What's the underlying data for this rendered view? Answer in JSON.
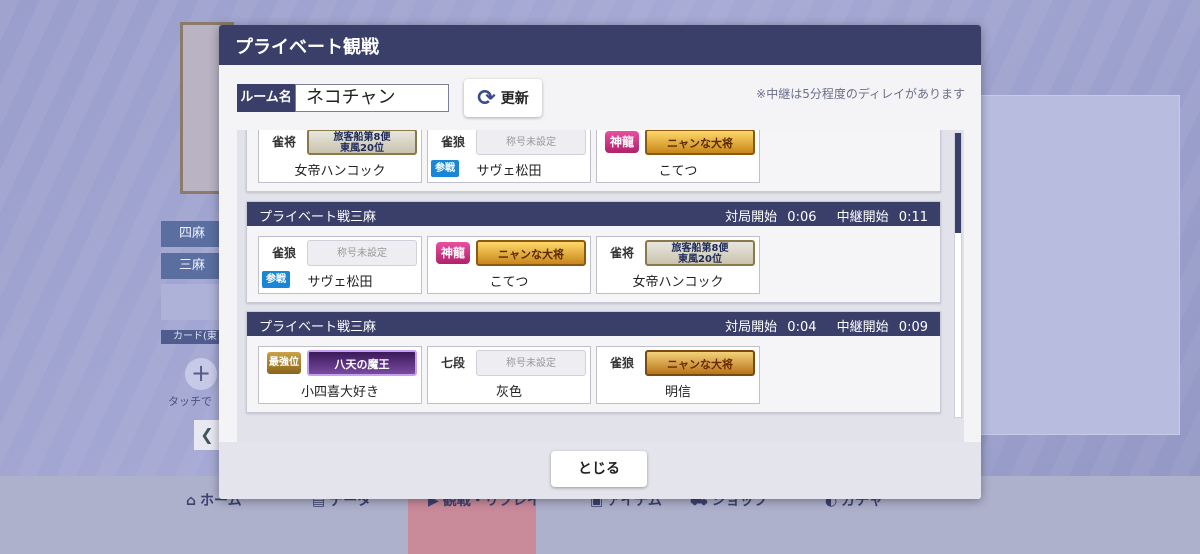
{
  "background": {
    "modes": [
      "四麻",
      "三麻"
    ],
    "card_label": "カード(東",
    "touch_text": "タッチで",
    "nav": [
      {
        "label": "ホーム",
        "icon": "home-icon",
        "glyph": "⌂"
      },
      {
        "label": "データ",
        "icon": "data-icon",
        "glyph": "▤"
      },
      {
        "label": "観戦・リプレイ",
        "icon": "replay-icon",
        "glyph": "▶"
      },
      {
        "label": "アイテム",
        "icon": "item-icon",
        "glyph": "▣"
      },
      {
        "label": "ショップ",
        "icon": "shop-icon",
        "glyph": "⛟"
      },
      {
        "label": "ガチャ",
        "icon": "gacha-icon",
        "glyph": "◐"
      }
    ]
  },
  "modal": {
    "title": "プライベート観戦",
    "delay_note": "※中継は5分程度のディレイがあります",
    "room_label": "ルーム名",
    "room_value": "ネコチャン",
    "refresh_label": "更新",
    "close_label": "とじる",
    "matches": [
      {
        "name": "",
        "start_label": "",
        "start": "",
        "relay_label": "",
        "relay": "",
        "players": [
          {
            "rank": "雀将",
            "rank_style": "plain",
            "title": "旅客船第8便\n東風20位",
            "title_style": "ship",
            "name": "女帝ハンコック",
            "join": ""
          },
          {
            "rank": "雀狼",
            "rank_style": "plain",
            "title": "称号未設定",
            "title_style": "unset",
            "name": "サヴェ松田",
            "join": "参戦"
          },
          {
            "rank": "神龍",
            "rank_style": "hot",
            "title": "ニャンな大将",
            "title_style": "gold",
            "name": "こてつ",
            "join": ""
          }
        ]
      },
      {
        "name": "プライベート戦三麻",
        "start_label": "対局開始",
        "start": "0:06",
        "relay_label": "中継開始",
        "relay": "0:11",
        "players": [
          {
            "rank": "雀狼",
            "rank_style": "plain",
            "title": "称号未設定",
            "title_style": "unset",
            "name": "サヴェ松田",
            "join": "参戦"
          },
          {
            "rank": "神龍",
            "rank_style": "hot",
            "title": "ニャンな大将",
            "title_style": "gold",
            "name": "こてつ",
            "join": ""
          },
          {
            "rank": "雀将",
            "rank_style": "plain",
            "title": "旅客船第8便\n東風20位",
            "title_style": "ship",
            "name": "女帝ハンコック",
            "join": ""
          }
        ]
      },
      {
        "name": "プライベート戦三麻",
        "start_label": "対局開始",
        "start": "0:04",
        "relay_label": "中継開始",
        "relay": "0:09",
        "players": [
          {
            "rank": "最強位",
            "rank_style": "gold",
            "title": "八天の魔王",
            "title_style": "dark",
            "name": "小四喜大好き",
            "join": ""
          },
          {
            "rank": "七段",
            "rank_style": "plain",
            "title": "称号未設定",
            "title_style": "unset",
            "name": "灰色",
            "join": ""
          },
          {
            "rank": "雀狼",
            "rank_style": "plain",
            "title": "ニャンな大将",
            "title_style": "mixed",
            "name": "明信",
            "join": ""
          }
        ]
      }
    ]
  }
}
